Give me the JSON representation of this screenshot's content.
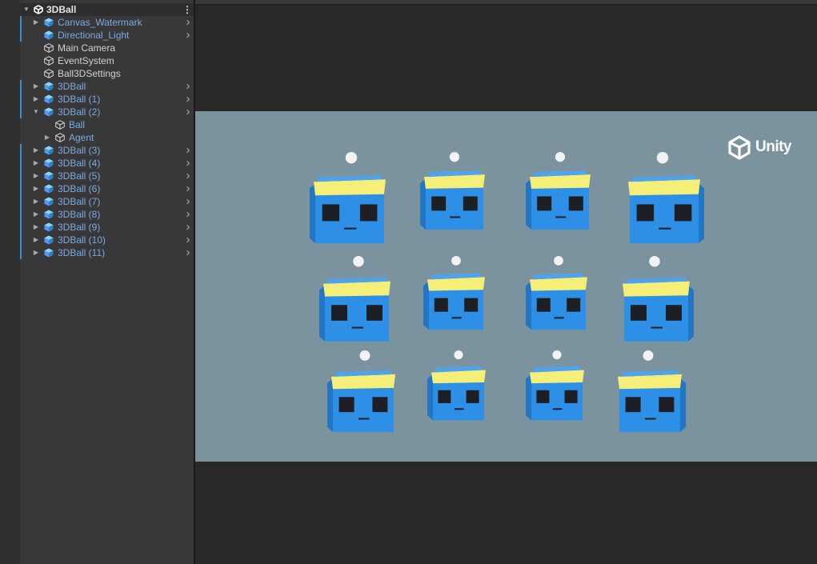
{
  "hierarchy": {
    "root": {
      "label": "3DBall",
      "menu_icon": "kebab-menu-icon"
    },
    "items": [
      {
        "label": "Canvas_Watermark",
        "kind": "prefab",
        "foldout": "collapsed",
        "indent": 1
      },
      {
        "label": "Directional_Light",
        "kind": "prefab",
        "foldout": "none",
        "indent": 1
      },
      {
        "label": "Main Camera",
        "kind": "object",
        "foldout": "none",
        "indent": 1
      },
      {
        "label": "EventSystem",
        "kind": "object",
        "foldout": "none",
        "indent": 1
      },
      {
        "label": "Ball3DSettings",
        "kind": "object",
        "foldout": "none",
        "indent": 1
      },
      {
        "label": "3DBall",
        "kind": "prefab",
        "foldout": "collapsed",
        "indent": 1
      },
      {
        "label": "3DBall (1)",
        "kind": "prefab",
        "foldout": "collapsed",
        "indent": 1
      },
      {
        "label": "3DBall (2)",
        "kind": "prefab",
        "foldout": "expanded",
        "indent": 1
      },
      {
        "label": "Ball",
        "kind": "prefab-child",
        "foldout": "none",
        "indent": 2
      },
      {
        "label": "Agent",
        "kind": "prefab-child",
        "foldout": "collapsed",
        "indent": 2
      },
      {
        "label": "3DBall (3)",
        "kind": "prefab",
        "foldout": "collapsed",
        "indent": 1
      },
      {
        "label": "3DBall (4)",
        "kind": "prefab",
        "foldout": "collapsed",
        "indent": 1
      },
      {
        "label": "3DBall (5)",
        "kind": "prefab",
        "foldout": "collapsed",
        "indent": 1
      },
      {
        "label": "3DBall (6)",
        "kind": "prefab",
        "foldout": "collapsed",
        "indent": 1
      },
      {
        "label": "3DBall (7)",
        "kind": "prefab",
        "foldout": "collapsed",
        "indent": 1
      },
      {
        "label": "3DBall (8)",
        "kind": "prefab",
        "foldout": "collapsed",
        "indent": 1
      },
      {
        "label": "3DBall (9)",
        "kind": "prefab",
        "foldout": "collapsed",
        "indent": 1
      },
      {
        "label": "3DBall (10)",
        "kind": "prefab",
        "foldout": "collapsed",
        "indent": 1
      },
      {
        "label": "3DBall (11)",
        "kind": "prefab",
        "foldout": "collapsed",
        "indent": 1
      }
    ]
  },
  "game": {
    "watermark": "Unity",
    "agent_count": 12,
    "colors": {
      "background": "#7b939e",
      "cube_front": "#2e8fe6",
      "cube_side": "#2276c4",
      "headband": "#f5ef7a",
      "eyes": "#1d1f24",
      "ball": "#f2f2f2",
      "prefab_text": "#7ba9e6",
      "selection_bar": "#3d8bd8"
    }
  }
}
